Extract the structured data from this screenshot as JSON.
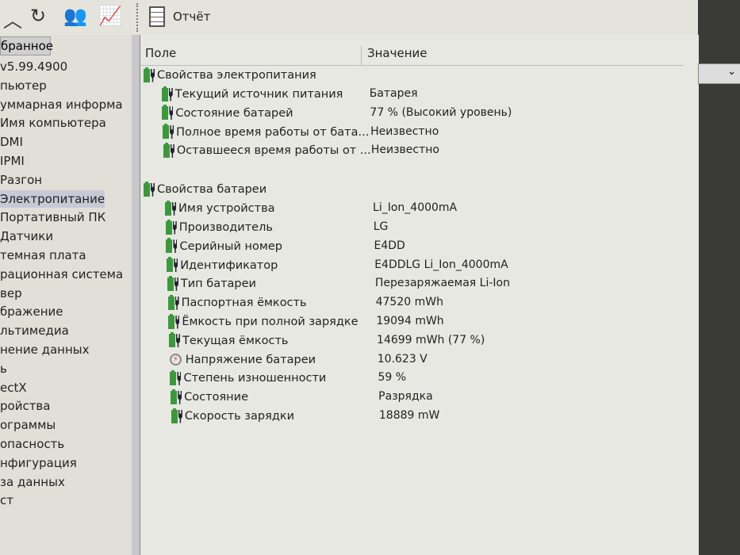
{
  "toolbar": {
    "report_label": "Отчёт",
    "icons": [
      "up-icon",
      "refresh-icon",
      "users-icon",
      "chart-icon",
      "report-icon"
    ]
  },
  "sidebar": {
    "tab_label": "бранное",
    "items": [
      {
        "label": "v5.99.4900"
      },
      {
        "label": "пьютер"
      },
      {
        "label": "уммарная информа"
      },
      {
        "label": "Имя компьютера"
      },
      {
        "label": "DMI"
      },
      {
        "label": "IPMI"
      },
      {
        "label": "Разгон"
      },
      {
        "label": "Электропитание",
        "selected": true
      },
      {
        "label": "Портативный ПК"
      },
      {
        "label": "Датчики"
      },
      {
        "label": "темная плата"
      },
      {
        "label": "рационная система"
      },
      {
        "label": "вер"
      },
      {
        "label": "бражение"
      },
      {
        "label": "льтимедиа"
      },
      {
        "label": "нение данных"
      },
      {
        "label": "ь"
      },
      {
        "label": "ectX"
      },
      {
        "label": "ройства"
      },
      {
        "label": "ограммы"
      },
      {
        "label": "опасность"
      },
      {
        "label": "нфигурация"
      },
      {
        "label": "за данных"
      },
      {
        "label": "ст"
      }
    ]
  },
  "table": {
    "col_field": "Поле",
    "col_value": "Значение",
    "groups": [
      {
        "title": "Свойства электропитания",
        "rows": [
          {
            "field": "Текущий источник питания",
            "value": "Батарея"
          },
          {
            "field": "Состояние батарей",
            "value": "77 % (Высокий уровень)"
          },
          {
            "field": "Полное время работы от бата...",
            "value": "Неизвестно"
          },
          {
            "field": "Оставшееся время работы от ...",
            "value": "Неизвестно"
          }
        ]
      },
      {
        "title": "Свойства батареи",
        "rows": [
          {
            "field": "Имя устройства",
            "value": "Li_Ion_4000mA"
          },
          {
            "field": "Производитель",
            "value": "LG"
          },
          {
            "field": "Серийный номер",
            "value": "E4DD"
          },
          {
            "field": "Идентификатор",
            "value": "E4DDLG Li_Ion_4000mA"
          },
          {
            "field": "Тип батареи",
            "value": "Перезаряжаемая Li-Ion"
          },
          {
            "field": "Паспортная ёмкость",
            "value": "47520 mWh"
          },
          {
            "field": "Ёмкость при полной зарядке",
            "value": "19094 mWh"
          },
          {
            "field": "Текущая ёмкость",
            "value": "14699 mWh  (77 %)"
          },
          {
            "field": "Напряжение батареи",
            "value": "10.623 V",
            "icon": "voltage"
          },
          {
            "field": "Степень изношенности",
            "value": "59 %"
          },
          {
            "field": "Состояние",
            "value": "Разрядка"
          },
          {
            "field": "Скорость зарядки",
            "value": "18889 mW"
          }
        ]
      }
    ]
  }
}
